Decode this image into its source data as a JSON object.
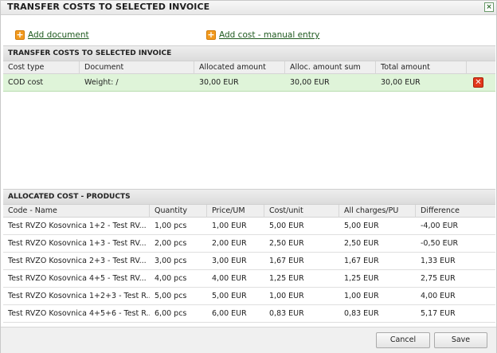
{
  "dialog": {
    "title": "TRANSFER COSTS TO SELECTED INVOICE",
    "close_label": "×"
  },
  "toolbar": {
    "add_document": "Add document",
    "add_cost": "Add cost - manual entry",
    "plus_symbol": "+"
  },
  "costs_panel": {
    "header": "TRANSFER COSTS TO SELECTED INVOICE",
    "columns": [
      "Cost type",
      "Document",
      "Allocated amount",
      "Alloc. amount sum",
      "Total amount"
    ],
    "rows": [
      {
        "cost_type": "COD cost",
        "document": "Weight: /",
        "allocated": "30,00 EUR",
        "alloc_sum": "30,00 EUR",
        "total": "30,00 EUR"
      }
    ],
    "delete_symbol": "✕"
  },
  "products_panel": {
    "header": "ALLOCATED COST - PRODUCTS",
    "columns": [
      "Code - Name",
      "Quantity",
      "Price/UM",
      "Cost/unit",
      "All charges/PU",
      "Difference"
    ],
    "rows": [
      {
        "code_name": "Test RVZO Kosovnica 1+2 - Test RV...",
        "quantity": "1,00 pcs",
        "price": "1,00 EUR",
        "cost_unit": "5,00 EUR",
        "all_charges": "5,00 EUR",
        "difference": "-4,00 EUR"
      },
      {
        "code_name": "Test RVZO Kosovnica 1+3 - Test RV...",
        "quantity": "2,00 pcs",
        "price": "2,00 EUR",
        "cost_unit": "2,50 EUR",
        "all_charges": "2,50 EUR",
        "difference": "-0,50 EUR"
      },
      {
        "code_name": "Test RVZO Kosovnica 2+3 - Test RV...",
        "quantity": "3,00 pcs",
        "price": "3,00 EUR",
        "cost_unit": "1,67 EUR",
        "all_charges": "1,67 EUR",
        "difference": "1,33 EUR"
      },
      {
        "code_name": "Test RVZO Kosovnica 4+5 - Test RV...",
        "quantity": "4,00 pcs",
        "price": "4,00 EUR",
        "cost_unit": "1,25 EUR",
        "all_charges": "1,25 EUR",
        "difference": "2,75 EUR"
      },
      {
        "code_name": "Test RVZO Kosovnica 1+2+3 - Test R...",
        "quantity": "5,00 pcs",
        "price": "5,00 EUR",
        "cost_unit": "1,00 EUR",
        "all_charges": "1,00 EUR",
        "difference": "4,00 EUR"
      },
      {
        "code_name": "Test RVZO Kosovnica 4+5+6 - Test R...",
        "quantity": "6,00 pcs",
        "price": "6,00 EUR",
        "cost_unit": "0,83 EUR",
        "all_charges": "0,83 EUR",
        "difference": "5,17 EUR"
      }
    ]
  },
  "footer": {
    "cancel_label": "Cancel",
    "save_label": "Save"
  },
  "colors": {
    "selected_row": "#dff4d9",
    "link_green": "#1f5a1f",
    "plus_orange": "#f29a1e",
    "delete_red": "#e2381c"
  }
}
